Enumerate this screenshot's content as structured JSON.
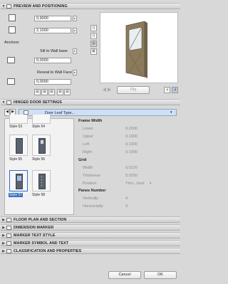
{
  "preview": {
    "header": "PREVIEW AND POSITIONING",
    "width_value": "0,9000",
    "height_value": "2,1000",
    "anchors_label": "Anchors:",
    "sill_label": "Sill to Wall base",
    "sill_value": "0,0000",
    "reveal_label": "Reveal to Wall Face",
    "reveal_value": "0,0000",
    "flip_label": "Flip"
  },
  "hinged": {
    "header": "HINGED DOOR SETTINGS",
    "dropdown": "Door Leaf Type...",
    "styles": [
      "Style 53",
      "Style 54",
      "Style 55",
      "Style 56",
      "Style 57",
      "Style 58"
    ],
    "frame_width_title": "Frame Width",
    "frame_rows": [
      {
        "label": "Lower",
        "value": "0,2000"
      },
      {
        "label": "Upper",
        "value": "0,1000"
      },
      {
        "label": "Left",
        "value": "0,1000"
      },
      {
        "label": "Right",
        "value": "0,1000"
      }
    ],
    "grid_title": "Grid",
    "grid_rows": [
      {
        "label": "Width",
        "value": "0,0120"
      },
      {
        "label": "Thickness",
        "value": "0,0250"
      },
      {
        "label": "Position",
        "value": "Thro...hout"
      }
    ],
    "panes_title": "Panes Number",
    "panes_rows": [
      {
        "label": "Vertically",
        "value": "4"
      },
      {
        "label": "Horizontally",
        "value": "3"
      }
    ]
  },
  "sections": [
    "FLOOR PLAN AND SECTION",
    "DIMENSION MARKER",
    "MARKER TEXT STYLE",
    "MARKER SYMBOL AND TEXT",
    "CLASSIFICATION AND PROPERTIES"
  ],
  "footer": {
    "cancel": "Cancel",
    "ok": "OK"
  },
  "colors": {
    "selected": "#2f6fc7",
    "header_bg": "#dcdcdc",
    "door_wood": "#8b7a5c"
  }
}
